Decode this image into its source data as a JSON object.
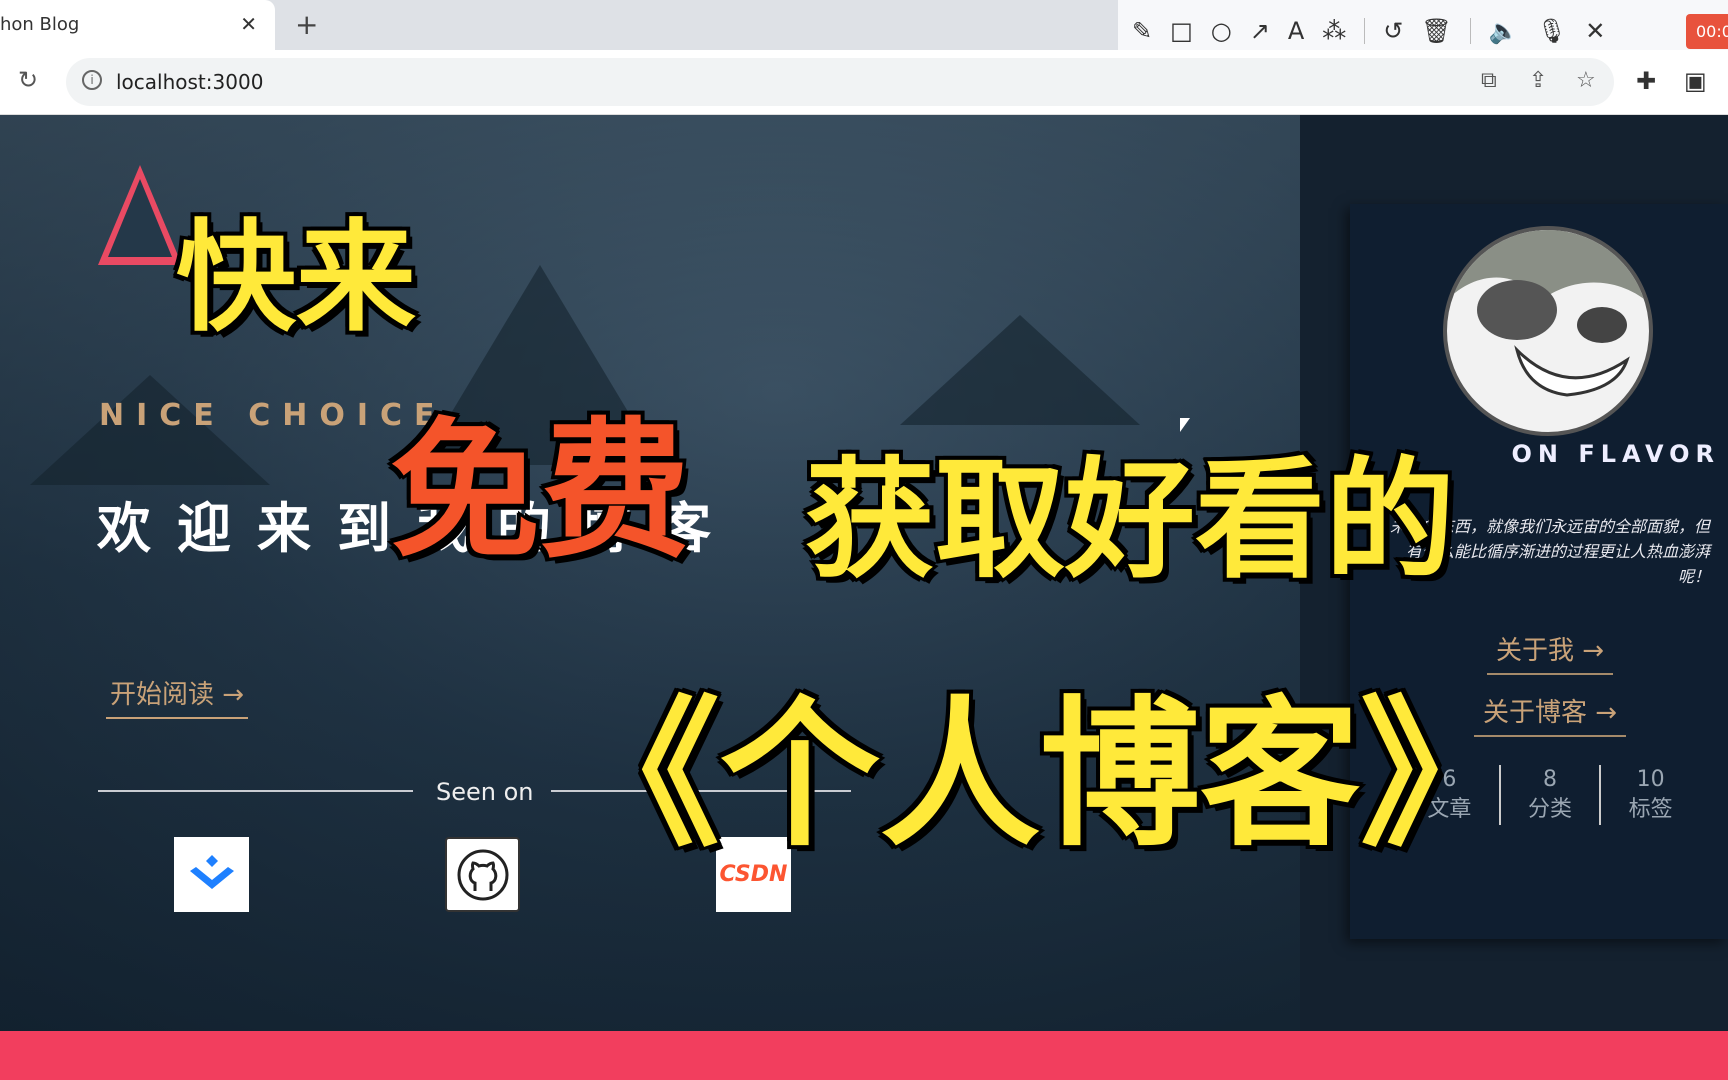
{
  "browser": {
    "tab_title": "hon Blog",
    "tab_close": "✕",
    "new_tab": "+",
    "url": "localhost:3000"
  },
  "annotation_toolbar": {
    "tools": [
      "pencil-icon",
      "rectangle-icon",
      "circle-icon",
      "arrow-icon",
      "text-icon",
      "magic-wand-icon",
      "undo-icon",
      "trash-icon",
      "speaker-icon",
      "microphone-icon",
      "close-icon"
    ],
    "timer": "00:0"
  },
  "hero": {
    "tagline": "NICE CHOICE",
    "welcome": "欢迎来到我的博客",
    "read_button": "开始阅读 →",
    "seen_on": "Seen on",
    "logos": [
      "juejin",
      "github",
      "CSDN"
    ]
  },
  "sidebar": {
    "name": "ON FLAVOR",
    "description": "未知的东西，就像我们永远宙的全部面貌，但有什么能比循序渐进的过程更让人热血澎湃呢！",
    "about_me": "关于我 →",
    "about_blog": "关于博客 →",
    "stats": [
      {
        "value": "6",
        "label": "文章"
      },
      {
        "value": "8",
        "label": "分类"
      },
      {
        "value": "10",
        "label": "标签"
      }
    ]
  },
  "overlay": {
    "line1": "快来",
    "line2": "免费",
    "line3": "获取好看的",
    "line4": "《个人博客》"
  },
  "colors": {
    "accent": "#c9a278",
    "logo": "#e94a63",
    "bottom_bar": "#f23e5e",
    "overlay_yellow": "#ffe93a",
    "overlay_orange": "#f4542a"
  }
}
